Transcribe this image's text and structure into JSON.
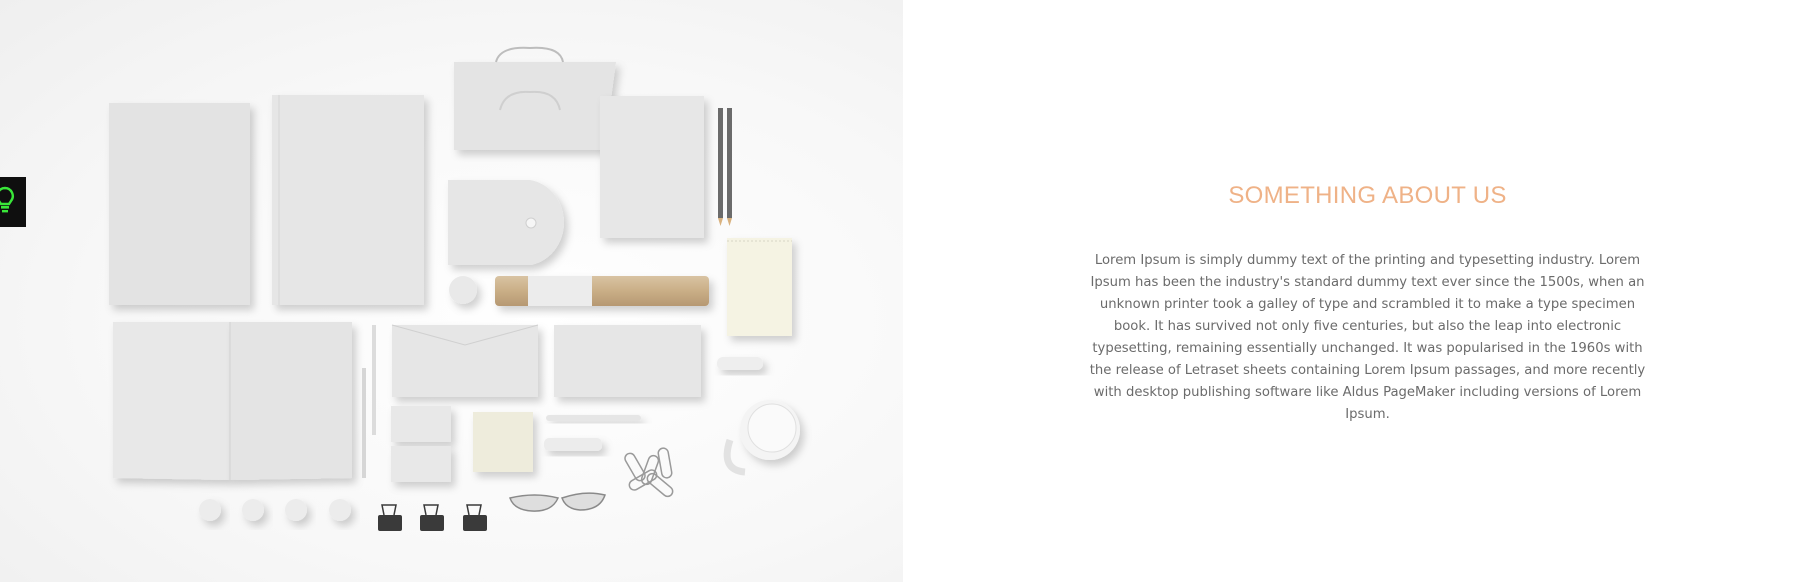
{
  "about": {
    "title": "SOMETHING ABOUT US",
    "body": "Lorem Ipsum is simply dummy text of the printing and typesetting industry. Lorem Ipsum has been the industry's standard dummy text ever since the 1500s, when an unknown printer took a galley of type and scrambled it to make a type specimen book. It has survived not only five centuries, but also the leap into electronic typesetting, remaining essentially unchanged. It was popularised in the 1960s with the release of Letraset sheets containing Lorem Ipsum passages, and more recently with desktop publishing software like Aldus PageMaker including versions of Lorem Ipsum."
  },
  "side_toggle": {
    "icon": "lightbulb-icon",
    "color": "#39e639"
  },
  "colors": {
    "title_accent": "#efb287",
    "body_text": "#6b6b6b",
    "toggle_bg": "#0f0f0f"
  }
}
